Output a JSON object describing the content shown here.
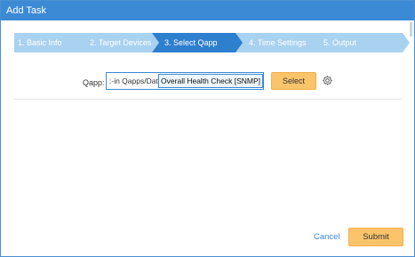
{
  "dialog": {
    "title": "Add Task"
  },
  "steps": [
    {
      "label": "1. Basic Info",
      "state": "inactive"
    },
    {
      "label": "2. Target Devices",
      "state": "inactive"
    },
    {
      "label": "3. Select Qapp",
      "state": "active"
    },
    {
      "label": "4. Time Settings",
      "state": "inactive"
    },
    {
      "label": "5. Output",
      "state": "inactive"
    }
  ],
  "qapp": {
    "label": "Qapp:",
    "path": ":-in Qapps/Data View/",
    "value": "Overall Health Check [SNMP]",
    "select_label": "Select",
    "settings_icon": "gear-icon"
  },
  "footer": {
    "cancel_label": "Cancel",
    "submit_label": "Submit"
  },
  "colors": {
    "titlebar": "#3c8ad6",
    "step_active": "#2f7fcf",
    "step_inactive": "#a9d2f0",
    "button": "#fbc46a",
    "link": "#3c8ad6"
  }
}
